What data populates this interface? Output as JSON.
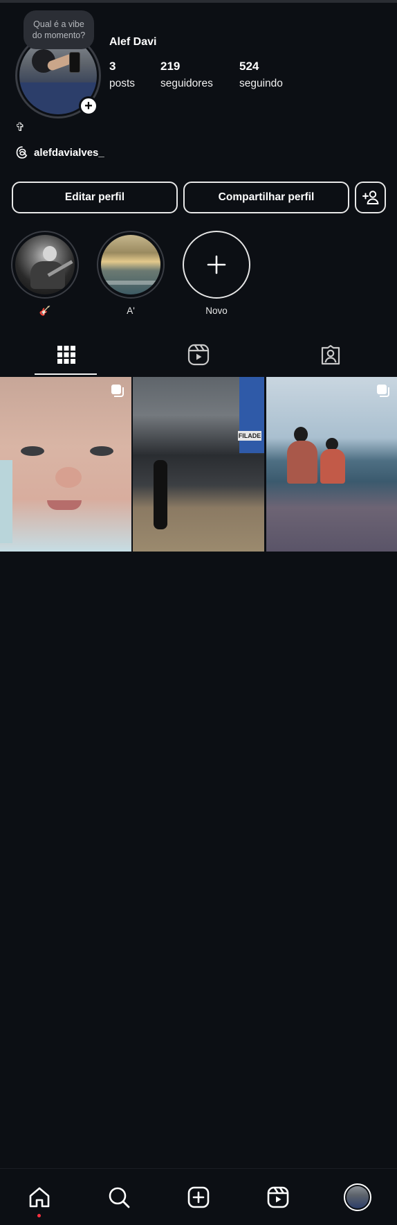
{
  "profile": {
    "name": "Alef Davi",
    "note": {
      "line1": "Qual é a vibe",
      "line2": "do momento?"
    },
    "bio_symbol": "✞",
    "threads_handle": "alefdavialves_",
    "stats": [
      {
        "value": "3",
        "label": "posts"
      },
      {
        "value": "219",
        "label": "seguidores"
      },
      {
        "value": "524",
        "label": "seguindo"
      }
    ]
  },
  "buttons": {
    "edit": "Editar perfil",
    "share": "Compartilhar perfil"
  },
  "highlights": [
    {
      "label": "🎸"
    },
    {
      "label": "A'"
    },
    {
      "label": "Novo"
    }
  ],
  "tabs": [
    "posts-grid",
    "reels",
    "tagged"
  ],
  "posts": [
    {
      "type": "carousel"
    },
    {
      "type": "single",
      "sign_text": "FILADE"
    },
    {
      "type": "carousel"
    }
  ],
  "bottom_nav": [
    "home",
    "search",
    "create",
    "reels",
    "profile"
  ],
  "colors": {
    "background": "#0c0f14",
    "text": "#f5f5f5",
    "notification_dot": "#ff3040"
  }
}
